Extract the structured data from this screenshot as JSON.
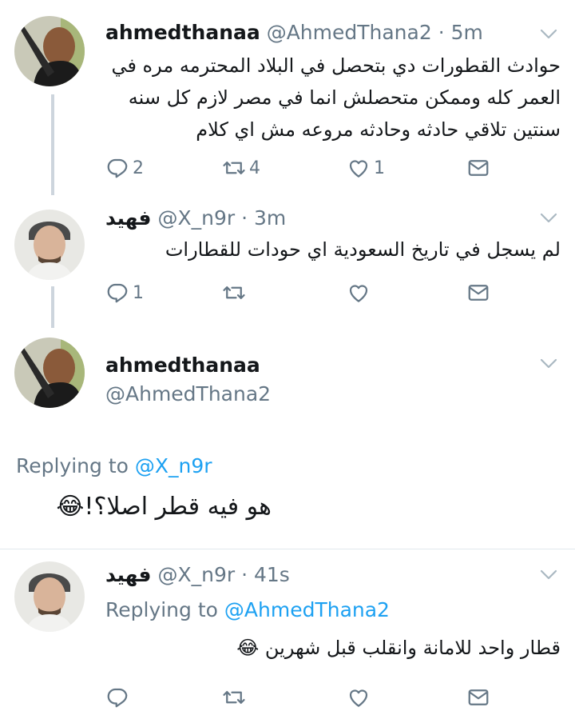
{
  "tweets": [
    {
      "name": "ahmedthanaa",
      "handle": "@AhmedThana2",
      "time": "5m",
      "text": [
        "حوادث القطورات دي بتحصل في البلاد المحترمه مره في",
        "العمر كله وممكن متحصلش انما في مصر لازم كل سنه",
        "سنتين تلاقي حادثه وحادثه مروعه مش اي كلام"
      ],
      "replies": "2",
      "retweets": "4",
      "likes": "1"
    },
    {
      "name": "فهيد",
      "handle": "@X_n9r",
      "time": "3m",
      "text": [
        "لم يسجل في تاريخ السعودية اي حودات للقطارات"
      ],
      "replies": "1"
    },
    {
      "name": "ahmedthanaa",
      "handle": "@AhmedThana2",
      "replying_label": "Replying to",
      "replying_to": "@X_n9r",
      "text": "هو فيه قطر اصلا؟!😂"
    },
    {
      "name": "فهيد",
      "handle": "@X_n9r",
      "time": "41s",
      "replying_label": "Replying to",
      "replying_to": "@AhmedThana2",
      "text": "قطار واحد للامانة وانقلب قبل شهرين 😂"
    }
  ],
  "colors": {
    "text": "#14171a",
    "secondary": "#657786",
    "link": "#1da1f2",
    "line": "#cdd5dd"
  },
  "icons": [
    "reply-icon",
    "retweet-icon",
    "like-icon",
    "message-icon",
    "chevron-down-icon"
  ]
}
